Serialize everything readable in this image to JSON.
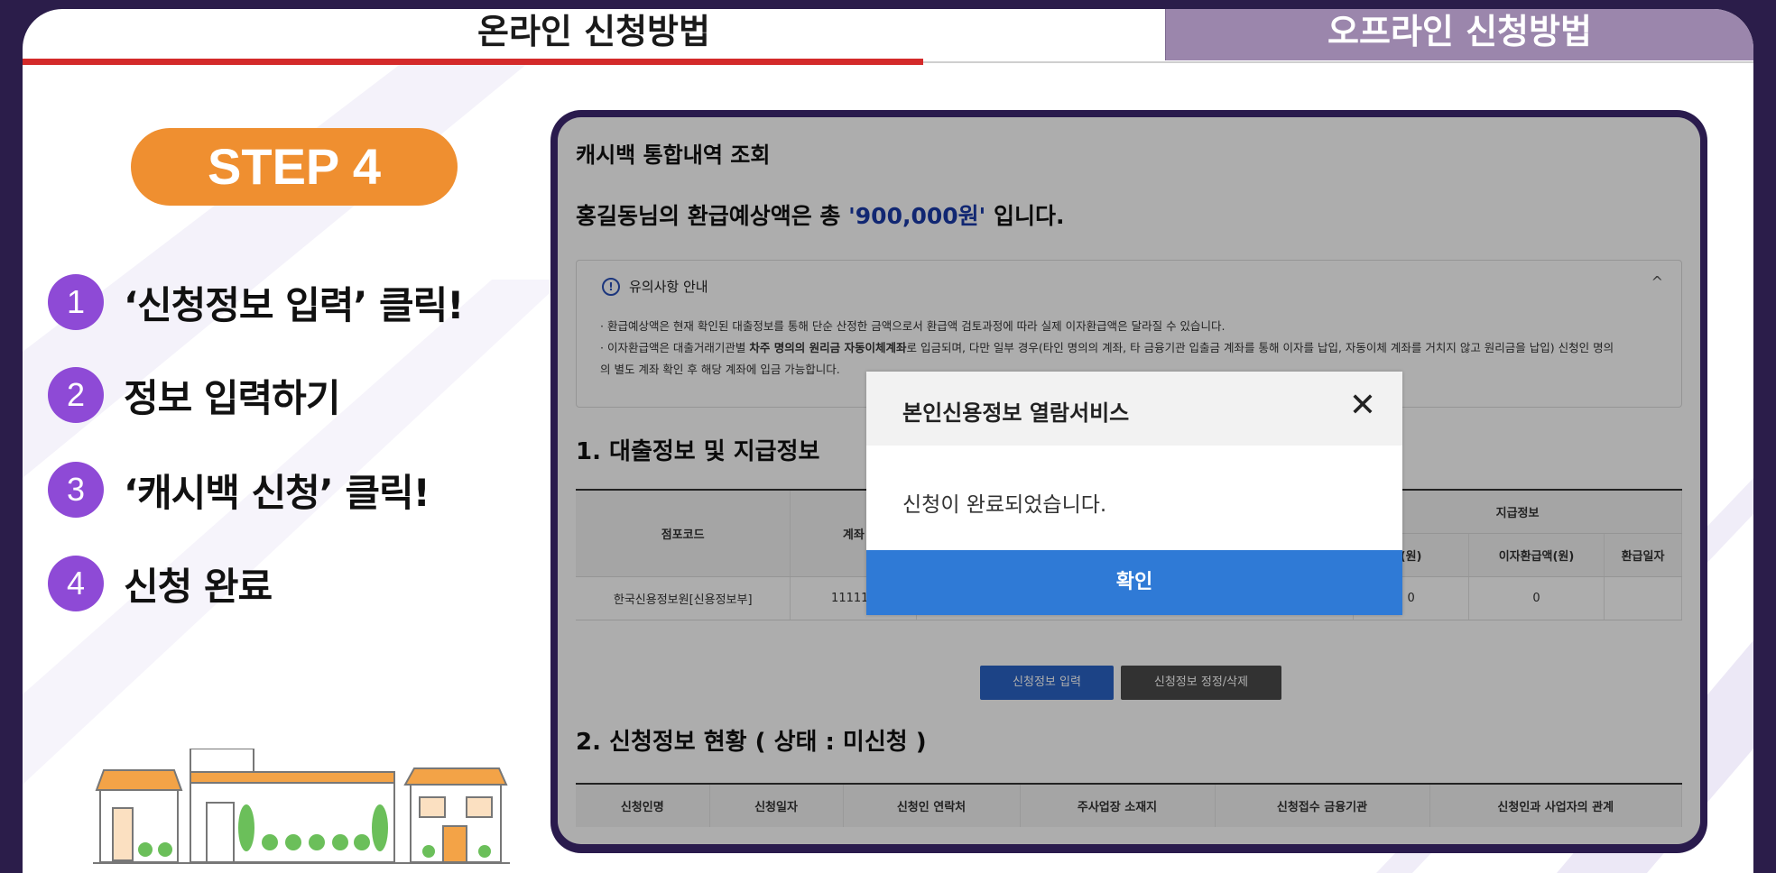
{
  "tabs": {
    "online": "온라인 신청방법",
    "offline": "오프라인 신청방법"
  },
  "step_badge": "STEP 4",
  "steps": [
    {
      "num": "1",
      "text": "‘신청정보 입력’ 클릭!"
    },
    {
      "num": "2",
      "text": "정보 입력하기"
    },
    {
      "num": "3",
      "text": "‘캐시백 신청’ 클릭!"
    },
    {
      "num": "4",
      "text": "신청 완료"
    }
  ],
  "screen": {
    "title": "캐시백 통합내역 조회",
    "refund_prefix": "홍길동님의 환급예상액은 총 ",
    "refund_amount": "'900,000원'",
    "refund_suffix": " 입니다.",
    "notice": {
      "icon": "!",
      "heading": "유의사항 안내",
      "chevron": "^",
      "line1": "· 환급예상액은 현재 확인된 대출정보를 통해 단순 산정한 금액으로서 환급액 검토과정에 따라 실제 이자환급액은 달라질 수 있습니다.",
      "line2_a": "· 이자환급액은 대출거래기관별 ",
      "line2_b": "차주 명의의 원리금 자동이체계좌",
      "line2_c": "로 입금되며, 다만 일부 경우(타인 명의의 계좌, 타 금융기관 입출금 계좌를 통해 이자를 납입, 자동이체 계좌를 거치지 않고 원리금을 납입) 신청인 명의",
      "line3": "의 별도 계좌 확인 후 해당 계좌에 입금 가능합니다."
    },
    "section1": "1. 대출정보 및 지급정보",
    "table1": {
      "h_branch": "점포코드",
      "h_account": "계좌",
      "h_payinfo": "지급정보",
      "h_sub1": "(원)",
      "h_sub2": "이자환급액(원)",
      "h_sub3": "환급일자",
      "r_branch": "한국신용정보원[신용정보부]",
      "r_account": "111111",
      "r_c1": "0",
      "r_c2": "0",
      "r_c3": ""
    },
    "btn_input": "신청정보 입력",
    "btn_edit": "신청정보 정정/삭제",
    "section2": "2. 신청정보 현황 ( 상태 : 미신청 )",
    "table2": [
      "신청인명",
      "신청일자",
      "신청인 연락처",
      "주사업장 소재지",
      "신청접수 금융기관",
      "신청인과 사업자의 관계"
    ]
  },
  "modal": {
    "title": "본인신용정보 열람서비스",
    "close": "✕",
    "message": "신청이 완료되었습니다.",
    "ok": "확인"
  },
  "colors": {
    "accent_orange": "#ef8f30",
    "step_purple": "#8e4ad6",
    "tab_red": "#d42a2a",
    "modal_blue": "#2f7ad6"
  }
}
